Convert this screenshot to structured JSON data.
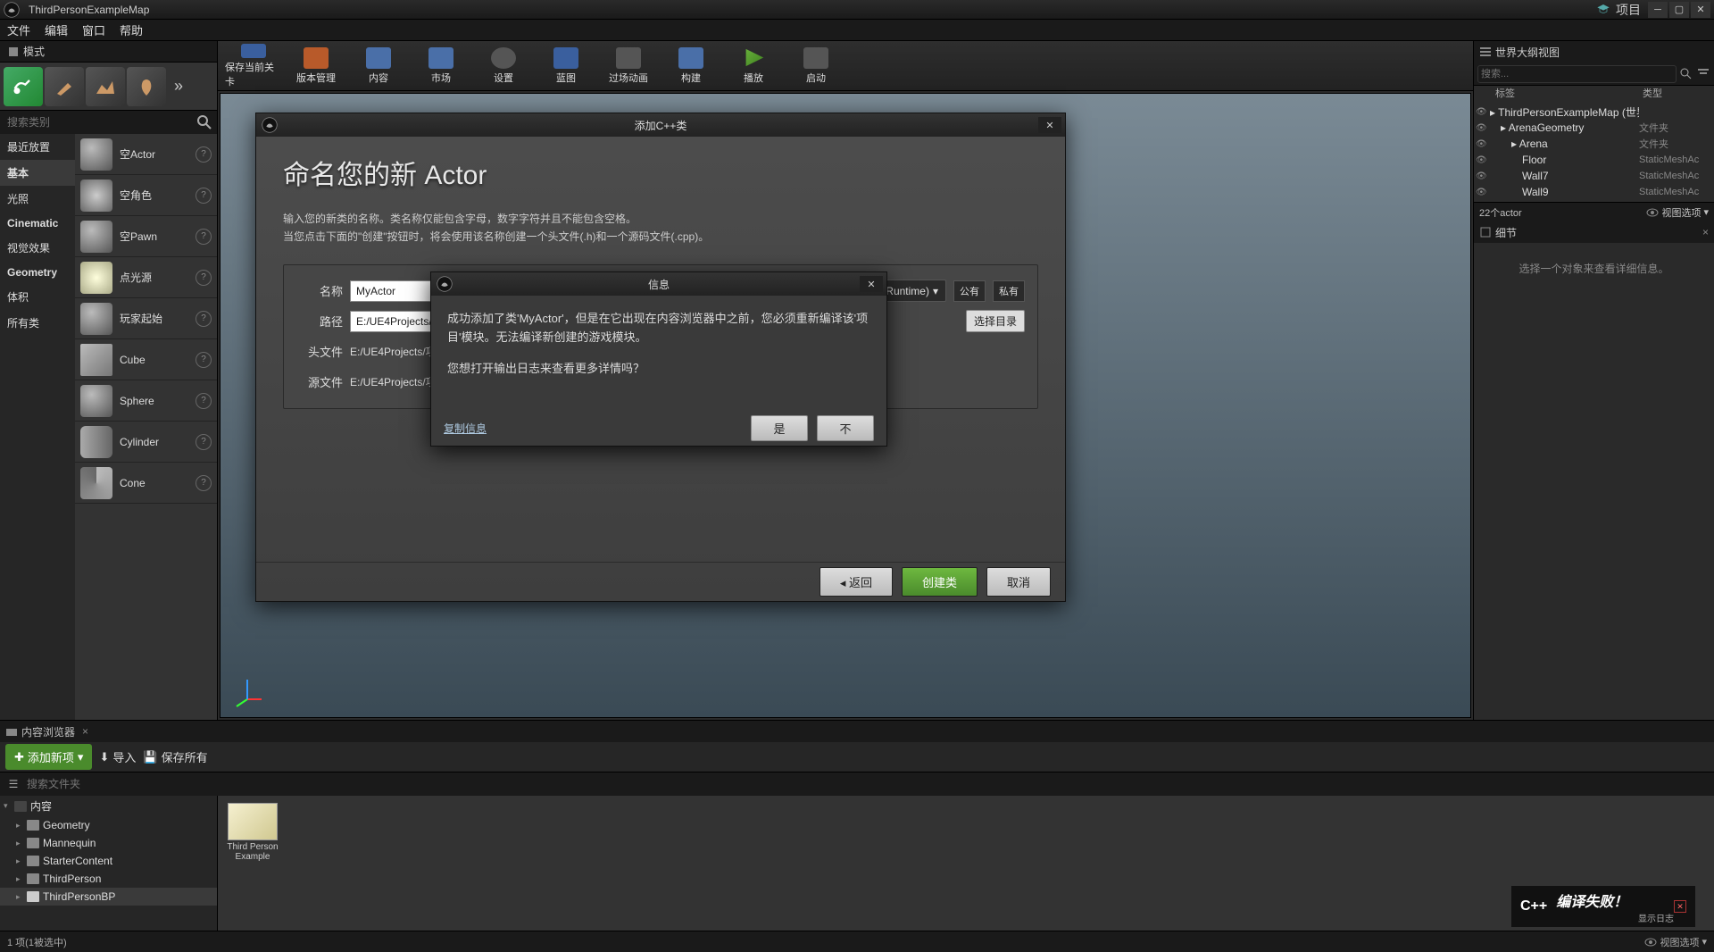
{
  "titlebar": {
    "title": "ThirdPersonExampleMap",
    "project_label": "项目"
  },
  "menubar": [
    "文件",
    "编辑",
    "窗口",
    "帮助"
  ],
  "modes": {
    "tab": "模式",
    "search_placeholder": "搜索类别",
    "categories": [
      "最近放置",
      "基本",
      "光照",
      "Cinematic",
      "视觉效果",
      "Geometry",
      "体积",
      "所有类"
    ],
    "actors": [
      "空Actor",
      "空角色",
      "空Pawn",
      "点光源",
      "玩家起始",
      "Cube",
      "Sphere",
      "Cylinder",
      "Cone"
    ]
  },
  "toolbar": [
    "保存当前关卡",
    "版本管理",
    "内容",
    "市场",
    "设置",
    "蓝图",
    "过场动画",
    "构建",
    "播放",
    "启动"
  ],
  "outliner": {
    "title": "世界大纲视图",
    "search_placeholder": "搜索...",
    "cols": {
      "label": "标签",
      "type": "类型"
    },
    "rows": [
      {
        "indent": 0,
        "label": "ThirdPersonExampleMap (世界",
        "type": ""
      },
      {
        "indent": 1,
        "label": "ArenaGeometry",
        "type": "文件夹"
      },
      {
        "indent": 2,
        "label": "Arena",
        "type": "文件夹"
      },
      {
        "indent": 3,
        "label": "Floor",
        "type": "StaticMeshAc"
      },
      {
        "indent": 3,
        "label": "Wall7",
        "type": "StaticMeshAc"
      },
      {
        "indent": 3,
        "label": "Wall9",
        "type": "StaticMeshAc"
      }
    ],
    "footer_count": "22个actor",
    "footer_view": "视图选项"
  },
  "details": {
    "title": "细节",
    "empty": "选择一个对象来查看详细信息。"
  },
  "content_browser": {
    "tab": "内容浏览器",
    "add_new": "添加新项",
    "import": "导入",
    "save_all": "保存所有",
    "search_placeholder": "搜索文件夹",
    "root": "内容",
    "folders": [
      "Geometry",
      "Mannequin",
      "StarterContent",
      "ThirdPerson",
      "ThirdPersonBP"
    ],
    "asset_label": "Third Person Example",
    "footer_count": "1 项(1被选中)",
    "footer_view": "视图选项"
  },
  "dialog_addclass": {
    "title": "添加C++类",
    "heading": "命名您的新 Actor",
    "desc1": "输入您的新类的名称。类名称仅能包含字母，数字字符并且不能包含空格。",
    "desc2": "当您点击下面的\"创建\"按钮时，将会使用该名称创建一个头文件(.h)和一个源码文件(.cpp)。",
    "labels": {
      "name": "名称",
      "path": "路径",
      "header": "头文件",
      "source": "源文件"
    },
    "values": {
      "name": "MyActor",
      "path": "E:/UE4Projects/项目/",
      "header": "E:/UE4Projects/项目/",
      "source": "E:/UE4Projects/项目/"
    },
    "dropdown": "项目 (Runtime)",
    "vis_public": "公有",
    "vis_private": "私有",
    "choose_dir": "选择目录",
    "back": "返回",
    "create": "创建类",
    "cancel": "取消"
  },
  "dialog_info": {
    "title": "信息",
    "body1": "成功添加了类'MyActor'，但是在它出现在内容浏览器中之前，您必须重新编译该'项目'模块。无法编译新创建的游戏模块。",
    "body2": "您想打开输出日志来查看更多详情吗？",
    "copy": "复制信息",
    "yes": "是",
    "no": "不"
  },
  "toast": {
    "cpp": "C++",
    "main": "编译失败！",
    "sub": "显示日志"
  }
}
